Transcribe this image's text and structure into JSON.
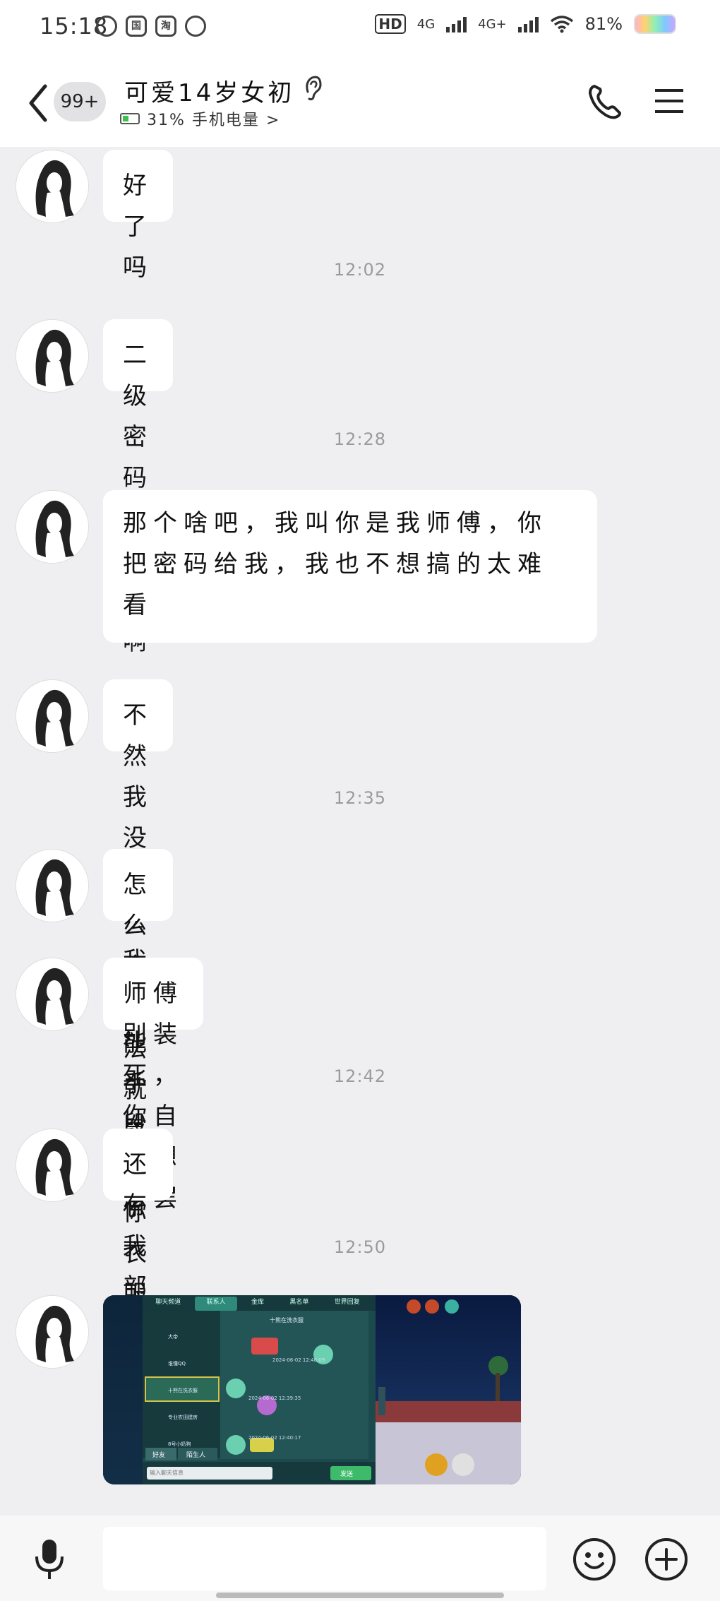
{
  "status_bar": {
    "time": "15:18",
    "app_icons": [
      "leaf-icon",
      "guo-icon",
      "tao-icon",
      "bank-icon"
    ],
    "app_icon_glyphs": [
      "",
      "国",
      "淘",
      ""
    ],
    "hd": "HD",
    "net1": "4G",
    "net2": "4G+",
    "battery": "81%"
  },
  "header": {
    "unread_badge": "99+",
    "contact_name": "可爱14岁女初",
    "phone_battery": "31% 手机电量 >"
  },
  "messages": [
    {
      "type": "text",
      "text": "好了吗"
    },
    {
      "type": "time",
      "text": "12:02"
    },
    {
      "type": "text",
      "text": "二级密码是多少啊"
    },
    {
      "type": "time",
      "text": "12:28"
    },
    {
      "type": "text",
      "text": "那个啥吧，我叫你是我师傅，你把密码给我，我也不想搞的太难看"
    },
    {
      "type": "text",
      "text": "不然我没办法我只能手段毒了"
    },
    {
      "type": "time",
      "text": "12:35"
    },
    {
      "type": "text",
      "text": "怎么个毒法就是把你衣服销了"
    },
    {
      "type": "text",
      "text": "师傅别装死，你自己想想罢"
    },
    {
      "type": "time",
      "text": "12:42"
    },
    {
      "type": "text",
      "text": "还有我部落去哪了"
    },
    {
      "type": "time",
      "text": "12:50"
    },
    {
      "type": "image",
      "screenshot_tabs": [
        "聊天频道",
        "联系人",
        "金库",
        "黑名单",
        "世界回复"
      ],
      "screenshot_contacts": [
        "大帝",
        "谁懂QQ",
        "十熊在洗衣服",
        "专业农田建房",
        "8号小奶狗"
      ],
      "screenshot_header": "十熊在洗衣服",
      "screenshot_msgs": [
        "2024-06-02 12:40:09",
        "2024-06-02 12:39:35",
        "2024-06-02 12:40:17"
      ],
      "screenshot_bottom_tabs": [
        "好友",
        "陌生人"
      ],
      "screenshot_input_placeholder": "输入聊天信息",
      "screenshot_send": "发送"
    }
  ],
  "input": {
    "value": ""
  }
}
